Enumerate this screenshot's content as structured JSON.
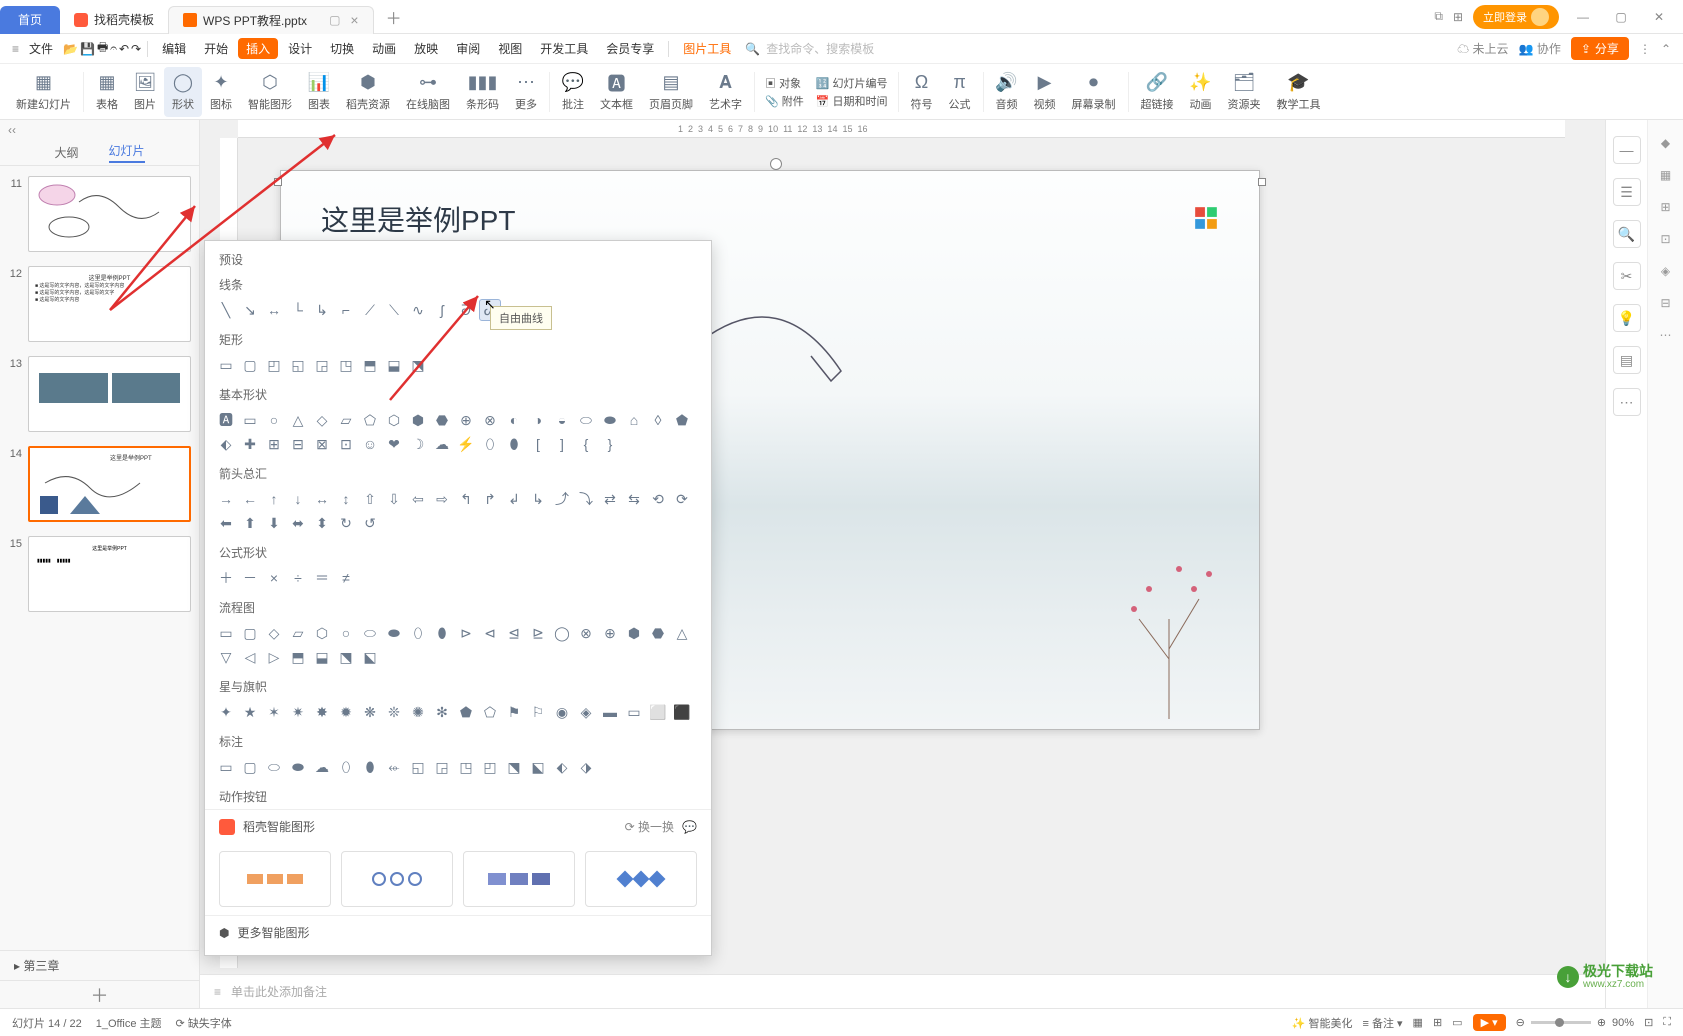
{
  "titlebar": {
    "home": "首页",
    "tab_template": "找稻壳模板",
    "tab_active": "WPS PPT教程.pptx",
    "login": "立即登录"
  },
  "menubar": {
    "file": "文件",
    "items": [
      "编辑",
      "开始",
      "插入",
      "设计",
      "切换",
      "动画",
      "放映",
      "审阅",
      "视图",
      "开发工具",
      "会员专享"
    ],
    "pic_tools": "图片工具",
    "search_ph": "查找命令、搜索模板",
    "cloud": "未上云",
    "coop": "协作",
    "share": "分享"
  },
  "ribbon": {
    "newslide": "新建幻灯片",
    "table": "表格",
    "picture": "图片",
    "shapes": "形状",
    "icon": "图标",
    "smartart": "智能图形",
    "chart": "图表",
    "dkres": "稻壳资源",
    "mindmap": "在线脑图",
    "barcode": "条形码",
    "more": "更多",
    "comment": "批注",
    "textbox": "文本框",
    "headerfooter": "页眉页脚",
    "wordart": "艺术字",
    "object": "对象",
    "slidenum": "幻灯片编号",
    "attach": "附件",
    "datetime": "日期和时间",
    "symbol": "符号",
    "formula": "公式",
    "audio": "音频",
    "video": "视频",
    "screenrec": "屏幕录制",
    "hyperlink": "超链接",
    "anim": "动画",
    "reslib": "资源夹",
    "teach": "教学工具"
  },
  "thumbs": {
    "outline": "大纲",
    "slides": "幻灯片",
    "chapter": "第三章"
  },
  "slide": {
    "title": "这里是举例PPT"
  },
  "popup": {
    "preset": "预设",
    "lines": "线条",
    "rect": "矩形",
    "basic": "基本形状",
    "arrows": "箭头总汇",
    "equation": "公式形状",
    "flowchart": "流程图",
    "stars": "星与旗帜",
    "callout": "标注",
    "action": "动作按钮",
    "smart": "稻壳智能图形",
    "refresh": "换一换",
    "moresmart": "更多智能图形",
    "tooltip": "自由曲线"
  },
  "notes": {
    "placeholder": "单击此处添加备注"
  },
  "status": {
    "slide": "幻灯片 14 / 22",
    "theme": "1_Office 主题",
    "missing": "缺失字体",
    "beautify": "智能美化",
    "notes": "备注",
    "zoom": "90%"
  },
  "watermark": {
    "site": "极光下载站",
    "url": "www.xz7.com"
  }
}
